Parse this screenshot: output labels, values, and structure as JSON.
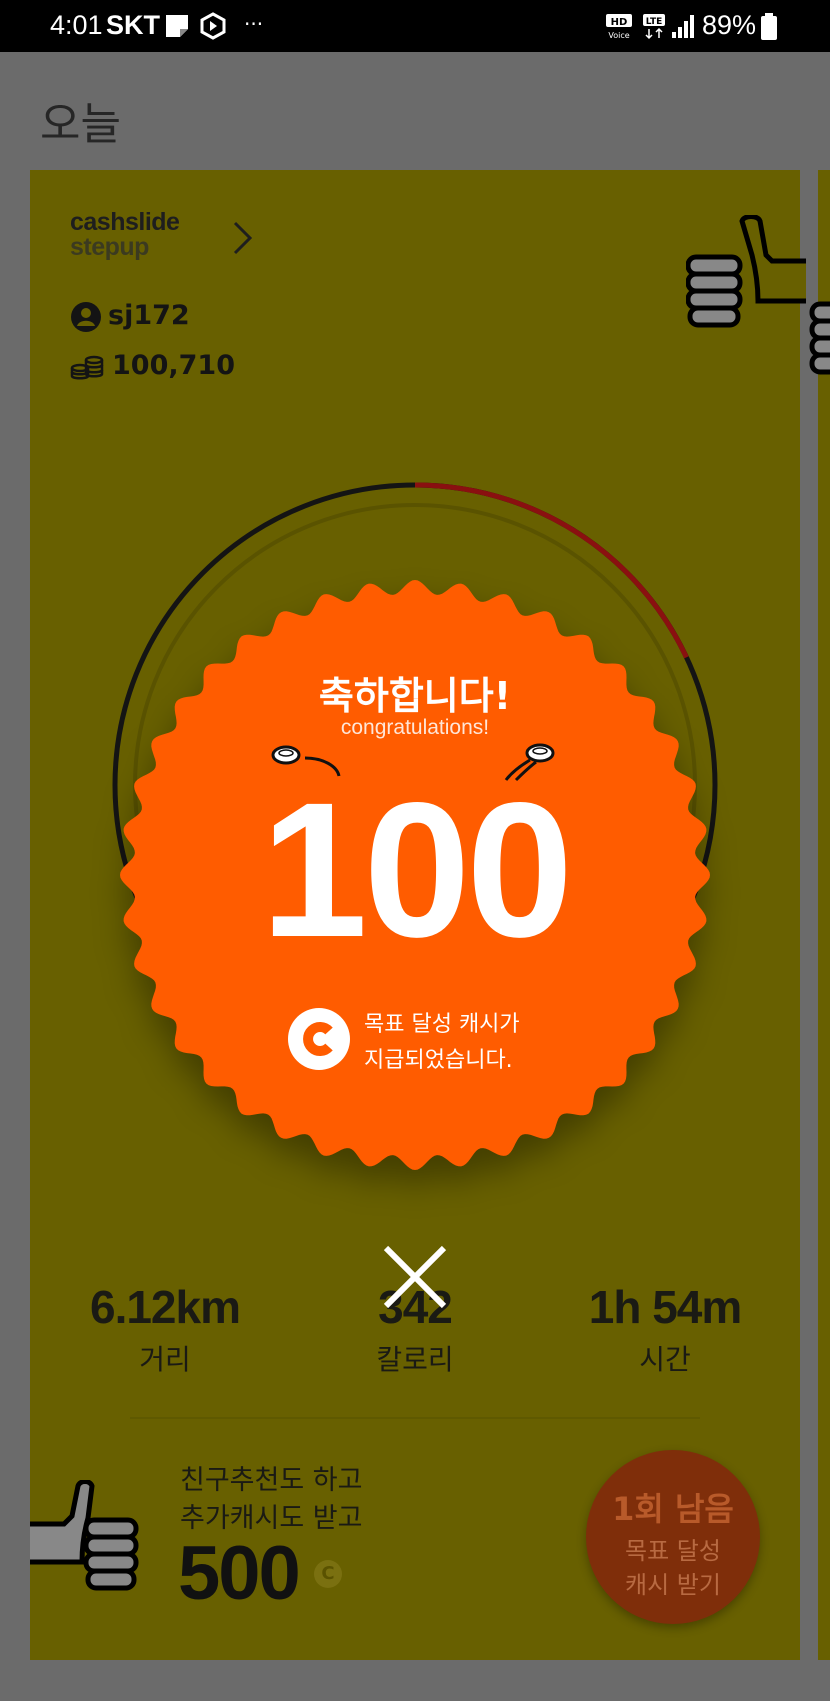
{
  "status_bar": {
    "time": "4:01",
    "carrier": "SKT",
    "dots": "···",
    "battery": "89%"
  },
  "screen_title": "오늘",
  "card": {
    "brand_line1": "cashslide",
    "brand_line2": "stepup",
    "username": "sj172",
    "cash": "100,710",
    "progress": 0.18
  },
  "stats": [
    {
      "value": "6.12km",
      "label": "거리"
    },
    {
      "value": "342",
      "label": "칼로리"
    },
    {
      "value": "1h 54m",
      "label": "시간"
    }
  ],
  "promo": {
    "line1": "친구추천도 하고",
    "line2": "추가캐시도 받고",
    "amount": "500",
    "coin": "C"
  },
  "claim_button": {
    "title": "1회 남음",
    "line1": "목표 달성",
    "line2": "캐시 받기"
  },
  "overlay": {
    "title": "축하합니다!",
    "subtitle": "congratulations!",
    "amount": "100",
    "message_line1": "목표 달성 캐시가",
    "message_line2": "지급되었습니다."
  },
  "colors": {
    "dim_background": "#6b6b6b",
    "card": "#686000",
    "badge": "#ff5c00",
    "claim_button": "#7f2e0a"
  }
}
